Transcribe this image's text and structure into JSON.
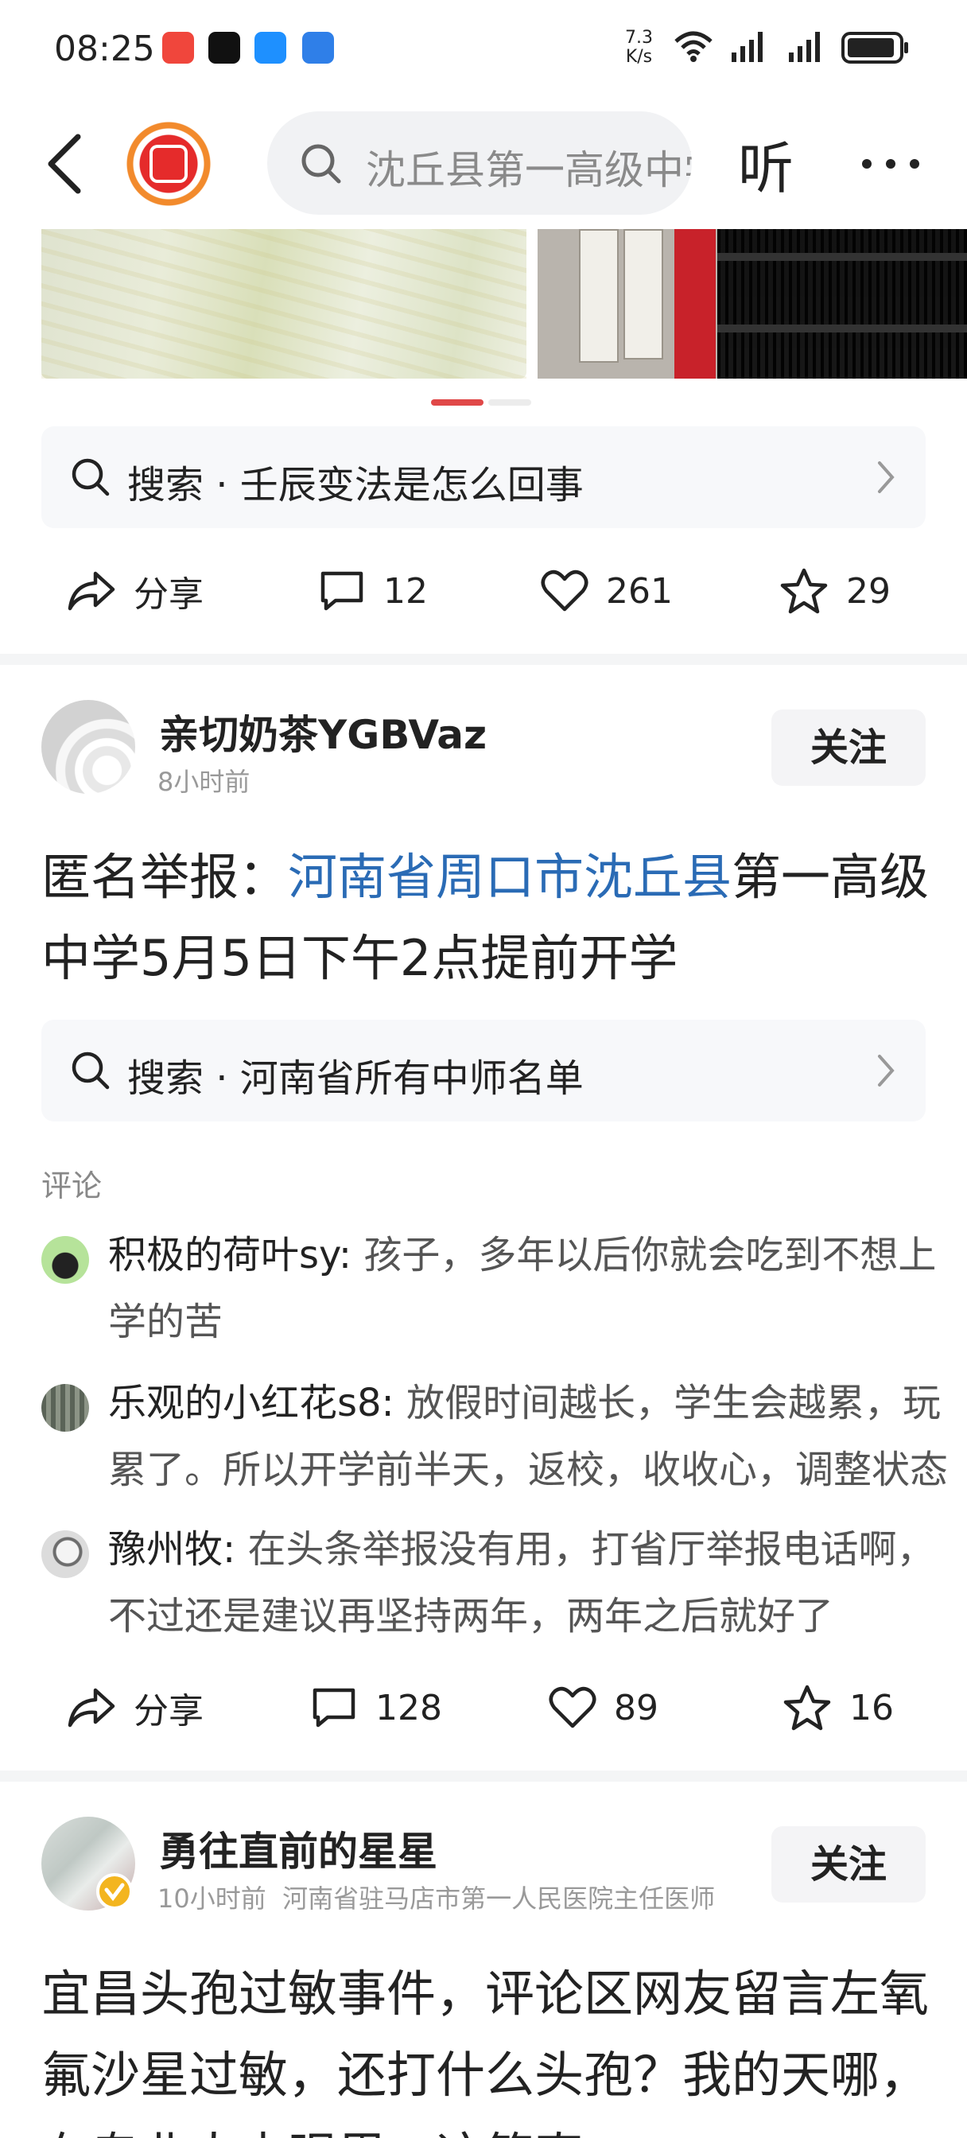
{
  "status_bar": {
    "time": "08:25",
    "net_speed_value": "7.3",
    "net_speed_unit": "K/s"
  },
  "nav": {
    "search_text": "沈丘县第一高级中学",
    "listen_label": "听"
  },
  "post1_footer": {
    "suggest_text": "搜索 · 壬辰变法是怎么回事",
    "share_label": "分享",
    "comments": "12",
    "likes": "261",
    "favorites": "29"
  },
  "post2": {
    "author": "亲切奶茶YGBVaz",
    "time": "8小时前",
    "follow_label": "关注",
    "title_prefix": "匿名举报：",
    "title_highlight": "河南省周口市沈丘县",
    "title_suffix": "第一高级中学5月5日下午2点提前开学",
    "suggest_text": "搜索 · 河南省所有中师名单",
    "comments_heading": "评论",
    "comment_list": [
      {
        "name": "积极的荷叶sy:",
        "text": " 孩子，多年以后你就会吃到不想上学的苦"
      },
      {
        "name": "乐观的小红花s8:",
        "text": " 放假时间越长，学生会越累，玩累了。所以开学前半天，返校，收收心，调整状态"
      },
      {
        "name": "豫州牧:",
        "text": " 在头条举报没有用，打省厅举报电话啊，不过还是建议再坚持两年，两年之后就好了"
      }
    ],
    "share_label": "分享",
    "comments": "128",
    "likes": "89",
    "favorites": "16"
  },
  "post3": {
    "author": "勇往直前的星星",
    "time": "10小时前",
    "source": "河南省驻马店市第一人民医院主任医师",
    "follow_label": "关注",
    "title": "宜昌头孢过敏事件，评论区网友留言左氧氟沙星过敏，还打什么头孢？我的天哪，在专业人士眼里，这简直"
  },
  "colors": {
    "accent_link": "#2a6bb5",
    "brand_red": "#e52b2b",
    "indicator_red": "#e04848"
  }
}
